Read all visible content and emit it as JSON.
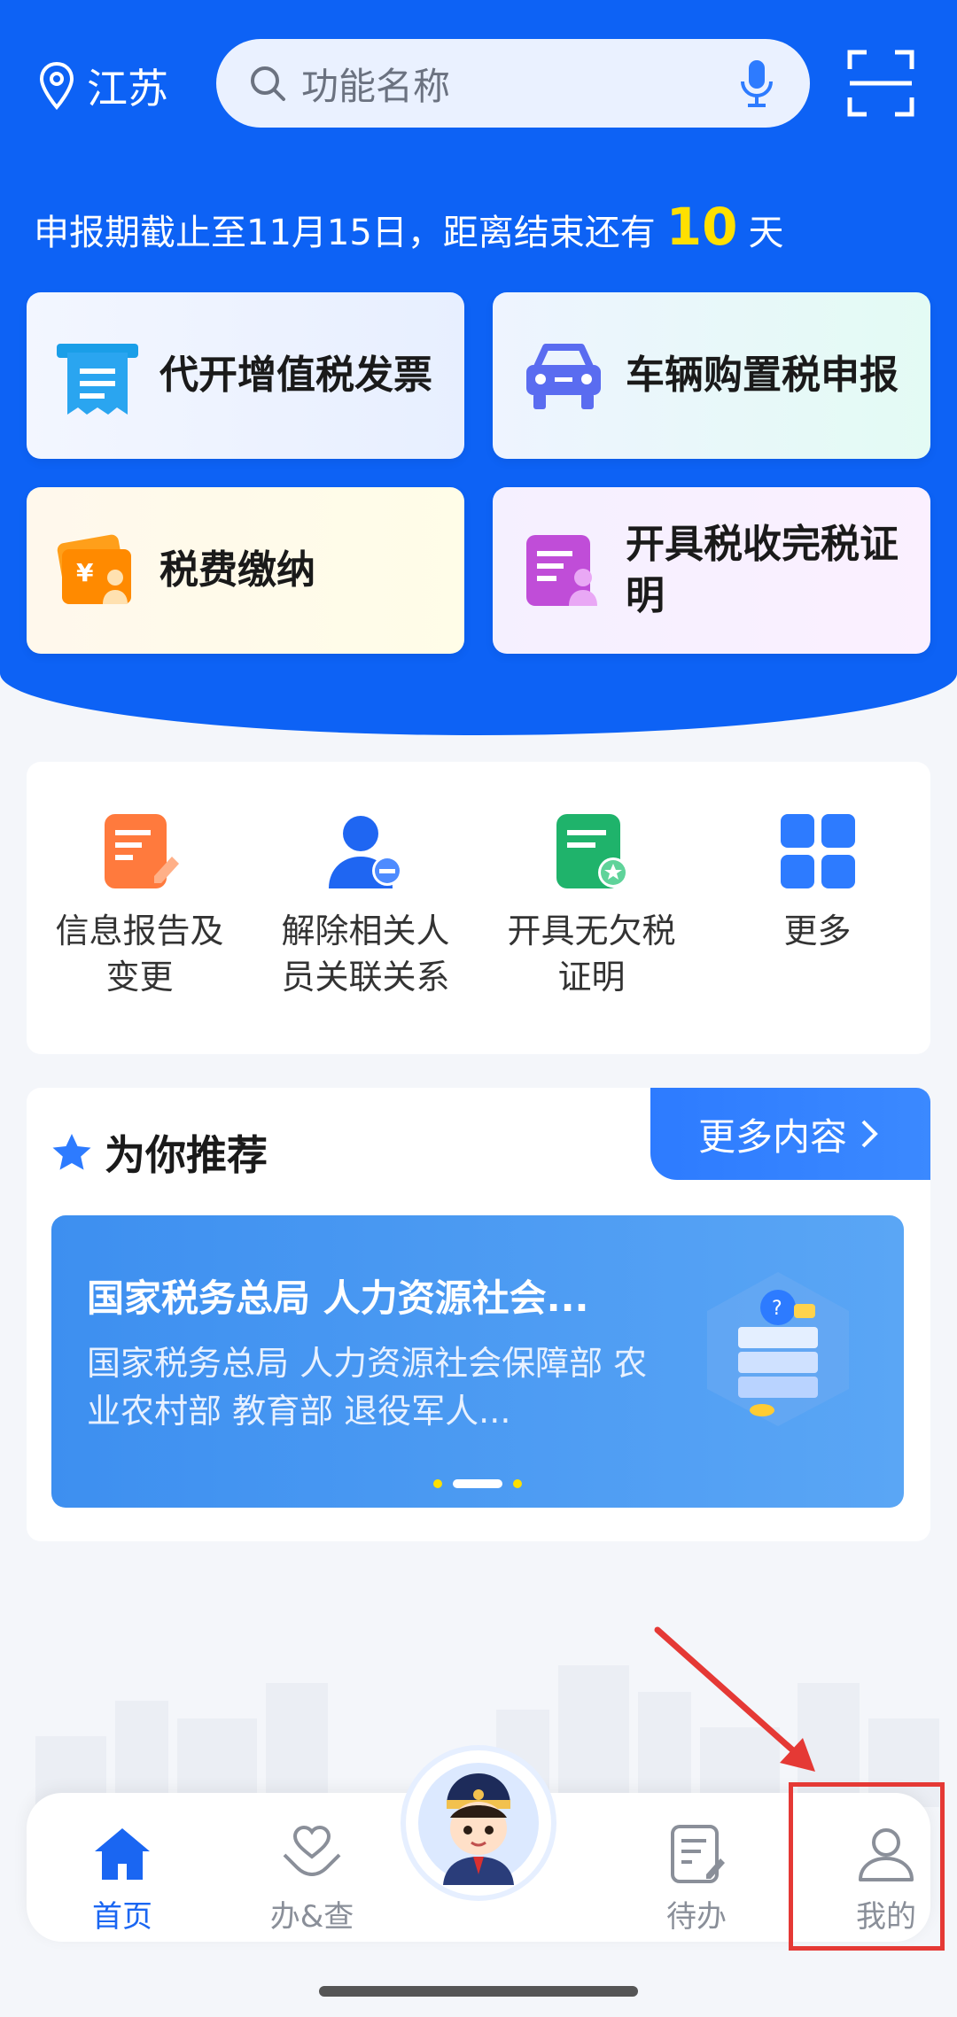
{
  "header": {
    "location": "江苏",
    "search_placeholder": "功能名称",
    "deadline_prefix": "申报期截止至11月15日，距离结束还有",
    "deadline_days": "10",
    "deadline_suffix": "天"
  },
  "main_cards": [
    {
      "label": "代开增值税发票",
      "icon": "invoice-icon"
    },
    {
      "label": "车辆购置税申报",
      "icon": "car-icon"
    },
    {
      "label": "税费缴纳",
      "icon": "wallet-icon"
    },
    {
      "label": "开具税收完税证明",
      "icon": "certificate-icon"
    }
  ],
  "quick_functions": [
    {
      "label": "信息报告及变更",
      "icon": "edit-document-icon"
    },
    {
      "label": "解除相关人员关联关系",
      "icon": "user-remove-icon"
    },
    {
      "label": "开具无欠税证明",
      "icon": "certificate-star-icon"
    },
    {
      "label": "更多",
      "icon": "grid-icon"
    }
  ],
  "recommend": {
    "title": "为你推荐",
    "more_label": "更多内容",
    "banner_title": "国家税务总局 人力资源社会...",
    "banner_desc": "国家税务总局 人力资源社会保障部 农业农村部 教育部 退役军人..."
  },
  "bottom_nav": [
    {
      "label": "首页",
      "icon": "home-icon",
      "active": true
    },
    {
      "label": "办&查",
      "icon": "heart-hands-icon",
      "active": false
    },
    {
      "label": "待办",
      "icon": "todo-icon",
      "active": false
    },
    {
      "label": "我的",
      "icon": "person-icon",
      "active": false
    }
  ],
  "colors": {
    "primary": "#0d62f5",
    "accent_yellow": "#ffe000",
    "highlight_red": "#e53935"
  }
}
